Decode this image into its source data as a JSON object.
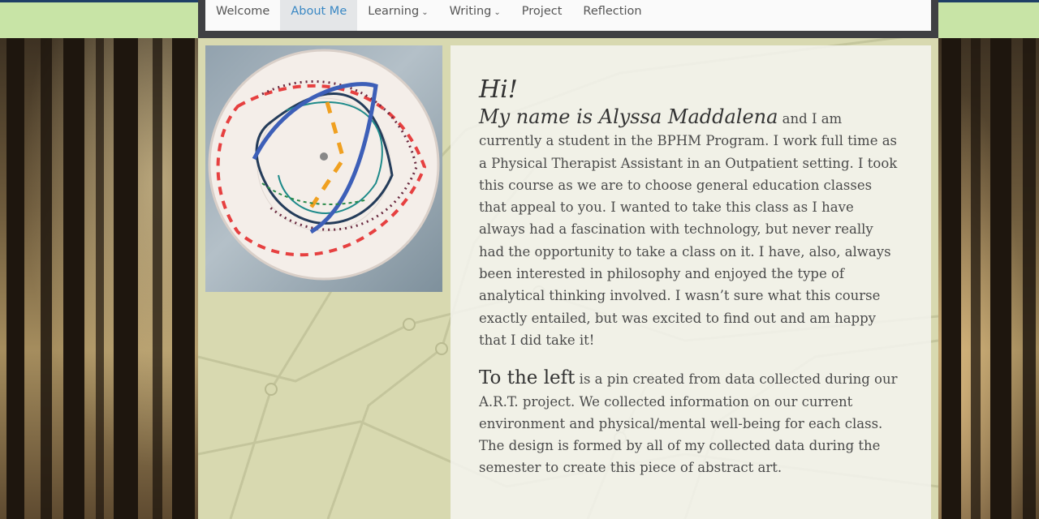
{
  "nav": {
    "items": [
      {
        "label": "Welcome",
        "active": false,
        "has_dropdown": false
      },
      {
        "label": "About Me",
        "active": true,
        "has_dropdown": false
      },
      {
        "label": "Learning",
        "active": false,
        "has_dropdown": true
      },
      {
        "label": "Writing",
        "active": false,
        "has_dropdown": true
      },
      {
        "label": "Project",
        "active": false,
        "has_dropdown": false
      },
      {
        "label": "Reflection",
        "active": false,
        "has_dropdown": false
      }
    ],
    "dropdown_icon": "chevron-down-icon"
  },
  "content": {
    "greeting": "Hi!",
    "intro_lead": "My name is Alyssa Maddalena",
    "intro_body": " and I am currently a student in the BPHM Program. I work full time as a Physical Therapist Assistant in an Outpatient setting. I took this course as we are to choose general education classes that appeal to you. I wanted to take this class as I have always had a fascination with technology, but never really had the opportunity to take a class on it. I have, also, always been interested in philosophy and enjoyed the type of analytical thinking involved. I wasn’t sure what this course exactly entailed, but was excited to find out and am happy that I did take it!",
    "pin_lead": "To the left",
    "pin_body": " is a pin created from data collected during our A.R.T. project. We collected information on our current environment and physical/mental well-being for each class. The design is formed by all of my collected data during the semester to create this piece of abstract art."
  },
  "colors": {
    "accent": "#3a88c4",
    "nav_active_bg": "#e4e6e8",
    "topbar": "#1f3f66",
    "side_green": "#c8e4a6"
  }
}
